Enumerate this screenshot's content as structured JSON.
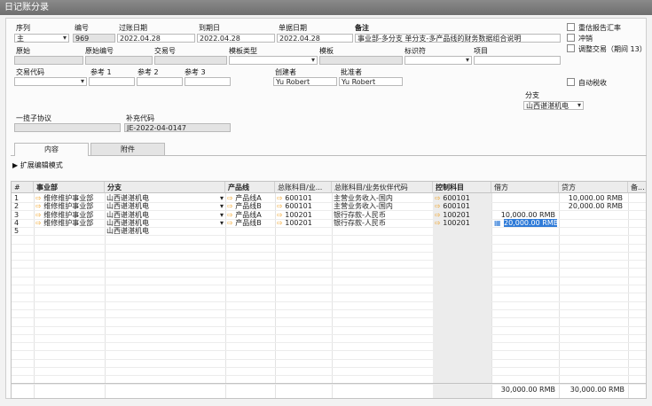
{
  "window": {
    "title": "日记账分录"
  },
  "header": {
    "series_label": "序列",
    "series_value": "主",
    "number_label": "编号",
    "number_value": "969",
    "posting_date_label": "过账日期",
    "posting_date_value": "2022.04.28",
    "due_date_label": "到期日",
    "due_date_value": "2022.04.28",
    "doc_date_label": "单据日期",
    "doc_date_value": "2022.04.28",
    "remarks_label": "备注",
    "remarks_value": "事业部-多分支 单分支-多产品线的财务数据组合说明",
    "origin_label": "原始",
    "origin_no_label": "原始编号",
    "trans_no_label": "交易号",
    "template_type_label": "模板类型",
    "template_label": "模板",
    "indicator_label": "标识符",
    "project_label": "项目",
    "trans_code_label": "交易代码",
    "ref1_label": "参考 1",
    "ref2_label": "参考 2",
    "ref3_label": "参考 3",
    "creator_label": "创建者",
    "creator_value": "Yu Robert",
    "approver_label": "批准者",
    "approver_value": "Yu Robert",
    "branch_label": "分支",
    "branch_value": "山西谌湛机电",
    "one_agreement_label": "一揽子协议",
    "supp_code_label": "补充代码",
    "supp_code_value": "JE-2022-04-0147",
    "checks": {
      "revalue_label": "重估报告汇率",
      "reverse_label": "冲销",
      "adjust_label": "调整交易（期间 13）",
      "auto_tax_label": "自动税收"
    }
  },
  "tabs": [
    {
      "label": "内容"
    },
    {
      "label": "附件"
    }
  ],
  "expand_mode_label": "扩展编辑模式",
  "table": {
    "columns": [
      "#",
      "事业部",
      "分支",
      "产品线",
      "总账科目/业...",
      "总账科目/业务伙伴代码",
      "控制科目",
      "借方",
      "贷方",
      "备..."
    ],
    "rows": [
      {
        "no": "1",
        "division": "维修维护事业部",
        "branch": "山西谌湛机电",
        "product": "产品线A",
        "account": "600101",
        "account_name": "主营业务收入-国内",
        "control": "600101",
        "debit": "",
        "credit": "10,000.00 RMB"
      },
      {
        "no": "2",
        "division": "维修维护事业部",
        "branch": "山西谌湛机电",
        "product": "产品线B",
        "account": "600101",
        "account_name": "主营业务收入-国内",
        "control": "600101",
        "debit": "",
        "credit": "20,000.00 RMB"
      },
      {
        "no": "3",
        "division": "维修维护事业部",
        "branch": "山西谌湛机电",
        "product": "产品线A",
        "account": "100201",
        "account_name": "银行存款-人民币",
        "control": "100201",
        "debit": "10,000.00 RMB",
        "credit": ""
      },
      {
        "no": "4",
        "division": "维修维护事业部",
        "branch": "山西谌湛机电",
        "product": "产品线B",
        "account": "100201",
        "account_name": "银行存款-人民币",
        "control": "100201",
        "debit": "20,000.00 RMB",
        "credit": ""
      },
      {
        "no": "5",
        "division": "",
        "branch": "山西谌湛机电",
        "product": "",
        "account": "",
        "account_name": "",
        "control": "",
        "debit": "",
        "credit": ""
      }
    ],
    "totals": {
      "debit": "30,000.00 RMB",
      "credit": "30,000.00 RMB"
    }
  }
}
